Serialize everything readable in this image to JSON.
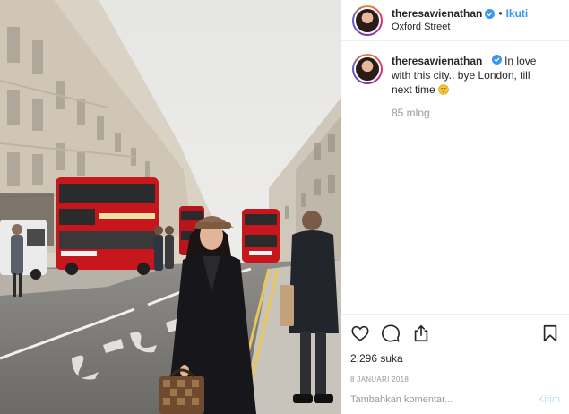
{
  "post": {
    "image_alt": "",
    "author": {
      "username": "theresawienathan",
      "verified": true,
      "location": "Oxford Street"
    },
    "follow_separator": "•",
    "follow_label": "Ikuti",
    "caption": {
      "username": "theresawienathan",
      "text": "In love with this city.. bye London, till next time",
      "emoji": "smiling-face-emoji"
    },
    "time_ago": "85 mlng",
    "likes": "2,296 suka",
    "date": "8 JANUARI 2018",
    "comment": {
      "placeholder": "Tambahkan komentar...",
      "send_label": "Kirim"
    },
    "icons": [
      "heart-icon",
      "comment-icon",
      "share-icon",
      "bookmark-icon",
      "verified-badge-icon"
    ],
    "colors": {
      "link": "#3897f0",
      "send_disabled": "#b2dffc",
      "muted": "#999999",
      "bus_red": "#c8161d"
    }
  }
}
